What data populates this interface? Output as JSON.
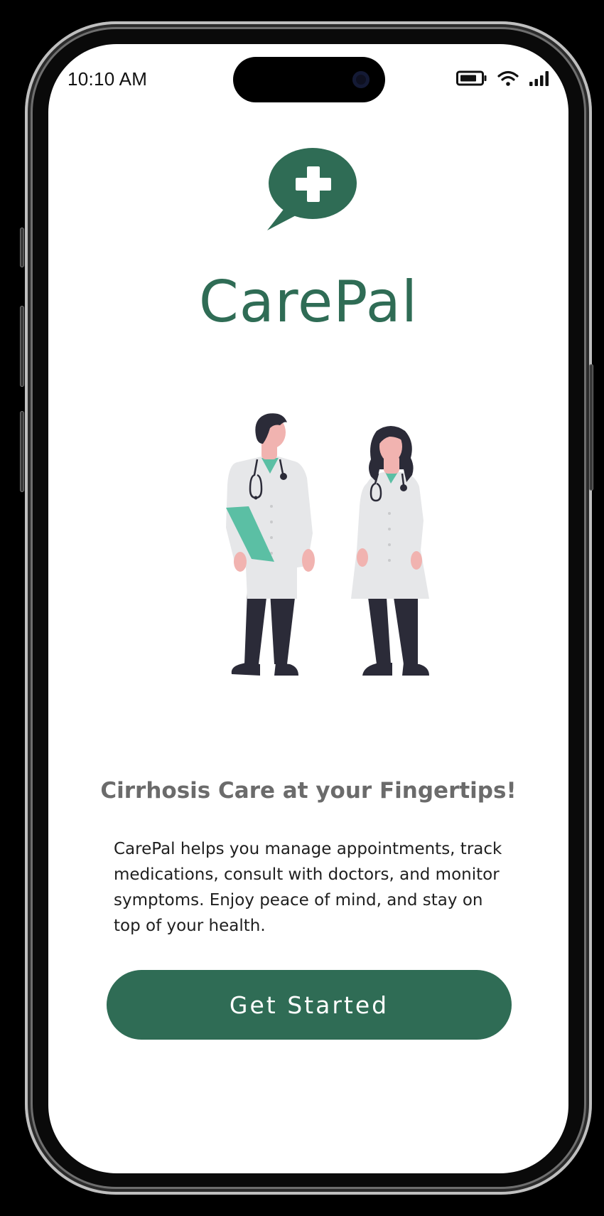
{
  "status_bar": {
    "time": "10:10 AM",
    "icons": [
      "battery-icon",
      "wifi-icon",
      "cellular-signal-icon"
    ]
  },
  "app": {
    "name": "CarePal",
    "logo_icon": "chat-bubble-medical-cross-icon"
  },
  "illustration": {
    "icon": "two-doctors-illustration"
  },
  "main": {
    "tagline": "Cirrhosis Care at your Fingertips!",
    "description": "CarePal helps you manage appointments, track medications, consult with doctors, and monitor symptoms. Enjoy peace of mind, and stay on top of your health.",
    "cta_label": "Get Started"
  },
  "colors": {
    "brand": "#2f6c55",
    "accent": "#5bbfa4",
    "tagline": "#6b6b6b",
    "text": "#1f1f1f",
    "background": "#ffffff"
  }
}
